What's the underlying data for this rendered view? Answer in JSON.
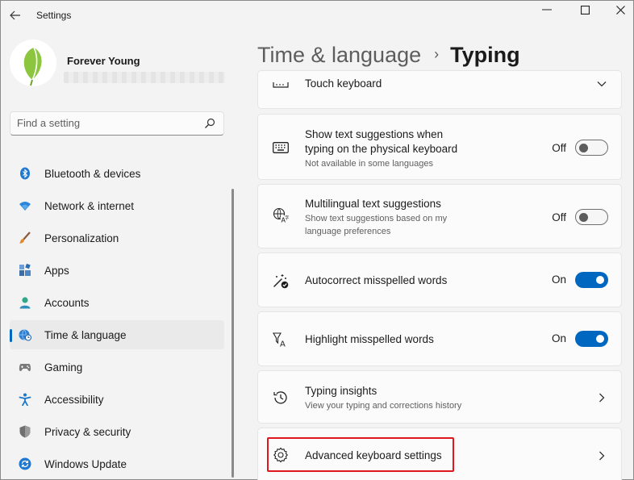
{
  "window": {
    "title": "Settings",
    "controls": {
      "minimize": "—",
      "maximize": "☐",
      "close": "✕"
    }
  },
  "profile": {
    "name": "Forever Young"
  },
  "search": {
    "placeholder": "Find a setting"
  },
  "sidebar": {
    "items": [
      {
        "label": "Bluetooth & devices",
        "icon": "bluetooth-icon",
        "active": false
      },
      {
        "label": "Network & internet",
        "icon": "wifi-icon",
        "active": false
      },
      {
        "label": "Personalization",
        "icon": "brush-icon",
        "active": false
      },
      {
        "label": "Apps",
        "icon": "apps-icon",
        "active": false
      },
      {
        "label": "Accounts",
        "icon": "account-icon",
        "active": false
      },
      {
        "label": "Time & language",
        "icon": "globe-clock-icon",
        "active": true
      },
      {
        "label": "Gaming",
        "icon": "gamepad-icon",
        "active": false
      },
      {
        "label": "Accessibility",
        "icon": "accessibility-icon",
        "active": false
      },
      {
        "label": "Privacy & security",
        "icon": "shield-icon",
        "active": false
      },
      {
        "label": "Windows Update",
        "icon": "update-icon",
        "active": false
      }
    ]
  },
  "header": {
    "parent": "Time & language",
    "separator": "›",
    "current": "Typing"
  },
  "settings": {
    "touch_keyboard": {
      "title": "Touch keyboard"
    },
    "text_suggestions": {
      "title_line1": "Show text suggestions when",
      "title_line2": "typing on the physical keyboard",
      "desc": "Not available in some languages",
      "state": "Off"
    },
    "multilingual": {
      "title": "Multilingual text suggestions",
      "desc_line1": "Show text suggestions based on my",
      "desc_line2": "language preferences",
      "state": "Off"
    },
    "autocorrect": {
      "title": "Autocorrect misspelled words",
      "state": "On"
    },
    "highlight": {
      "title": "Highlight misspelled words",
      "state": "On"
    },
    "typing_insights": {
      "title": "Typing insights",
      "desc": "View your typing and corrections history"
    },
    "advanced_keyboard": {
      "title": "Advanced keyboard settings"
    }
  },
  "colors": {
    "accent": "#0067c0",
    "highlight_border": "#e0171e",
    "leaf_green": "#8cc63f"
  }
}
